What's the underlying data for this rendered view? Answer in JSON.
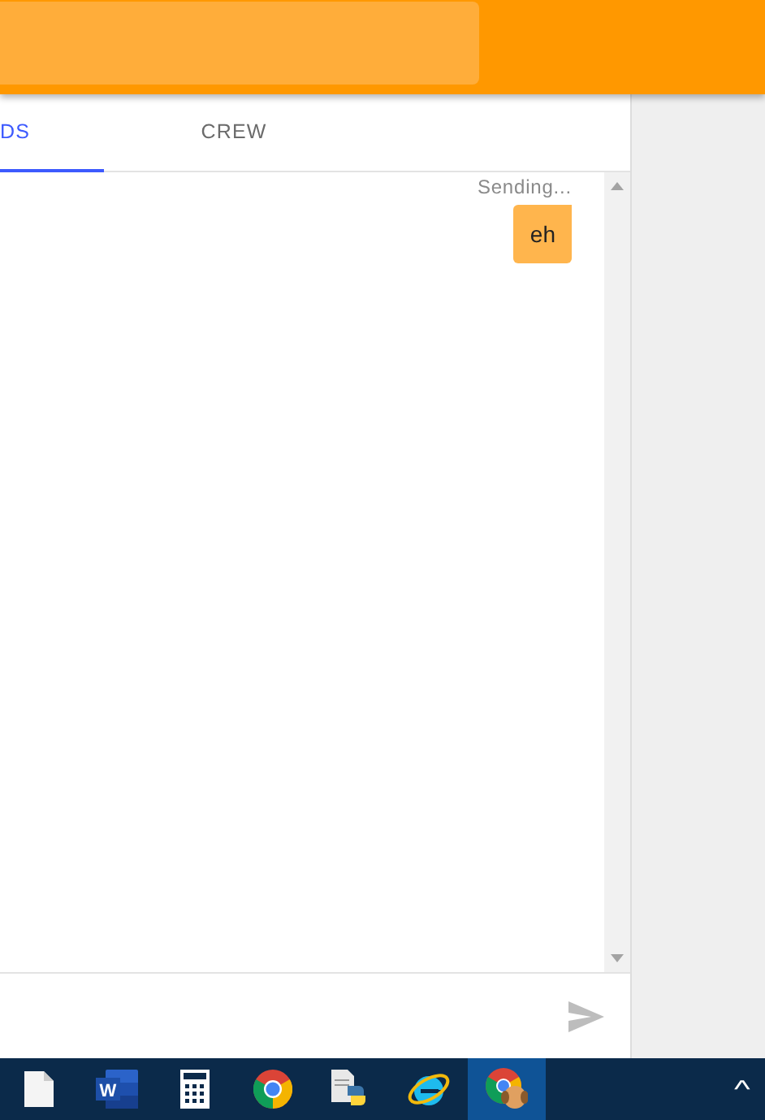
{
  "tabs": [
    {
      "label": "DS",
      "selected": true
    },
    {
      "label": "CREW",
      "selected": false
    }
  ],
  "messages": [
    {
      "status": "Sending...",
      "text": "eh"
    }
  ],
  "taskbar": {
    "items": [
      {
        "kind": "file",
        "active": false
      },
      {
        "kind": "word",
        "letter": "W",
        "active": false
      },
      {
        "kind": "calculator",
        "active": false
      },
      {
        "kind": "chrome",
        "active": false
      },
      {
        "kind": "python-file",
        "active": false
      },
      {
        "kind": "ie",
        "active": false
      },
      {
        "kind": "chrome-dog",
        "active": true
      }
    ],
    "tray_icon": "^"
  }
}
